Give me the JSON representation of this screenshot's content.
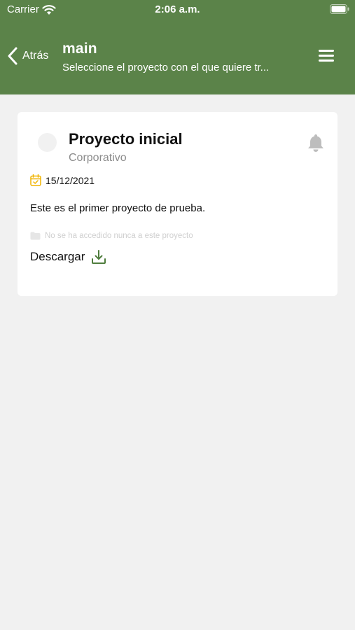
{
  "status_bar": {
    "carrier": "Carrier",
    "time": "2:06 a.m.",
    "icons": [
      "wifi-icon",
      "battery-icon"
    ]
  },
  "nav": {
    "back_label": "Atrás",
    "title": "main",
    "subtitle": "Seleccione el proyecto con el que quiere tr...",
    "menu_icon": "hamburger-menu-icon"
  },
  "project": {
    "name": "Proyecto inicial",
    "category": "Corporativo",
    "date": "15/12/2021",
    "description": "Este es el primer proyecto de prueba.",
    "access_note": "No se ha accedido nunca a este proyecto",
    "download_label": "Descargar"
  },
  "colors": {
    "header": "#5b8349",
    "background": "#f1f1f1",
    "accent_green": "#4f7d3d",
    "calendar_yellow": "#f0b400",
    "bell_gray": "#bdbdbd"
  }
}
